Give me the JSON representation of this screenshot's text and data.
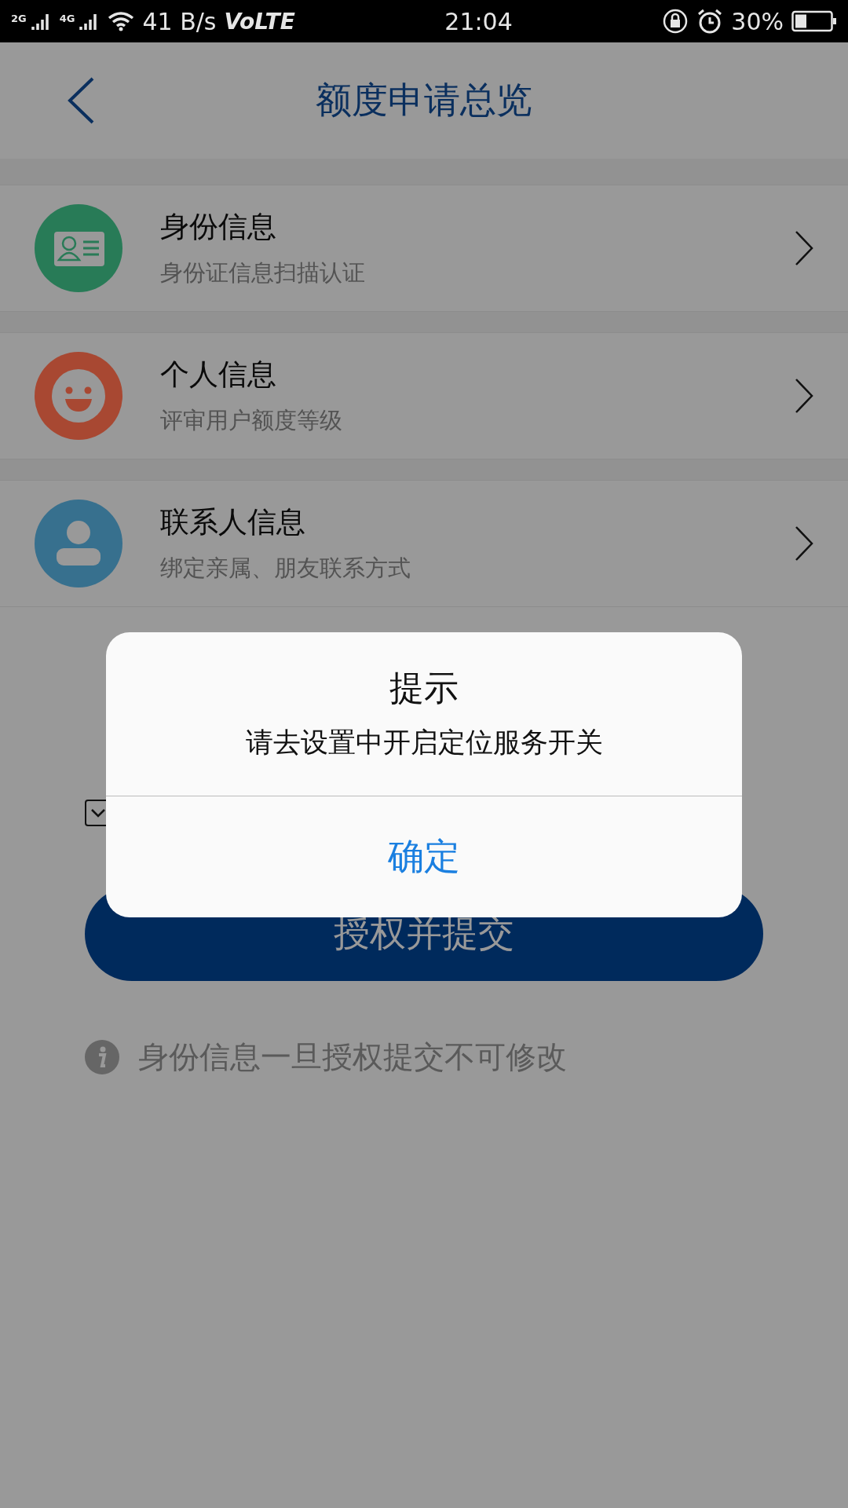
{
  "status_bar": {
    "network_1": "2G",
    "network_2": "4G",
    "speed": "41 B/s",
    "volte": "VoLTE",
    "time": "21:04",
    "battery": "30%"
  },
  "header": {
    "title": "额度申请总览"
  },
  "items": [
    {
      "kind": "id-card",
      "title": "身份信息",
      "subtitle": "身份证信息扫描认证",
      "color": "#287b57"
    },
    {
      "kind": "smile",
      "title": "个人信息",
      "subtitle": "评审用户额度等级",
      "color": "#a84832"
    },
    {
      "kind": "person",
      "title": "联系人信息",
      "subtitle": "绑定亲属、朋友联系方式",
      "color": "#37708e"
    }
  ],
  "agreement": {
    "checked": true
  },
  "submit_button": "授权并提交",
  "notice": "身份信息一旦授权提交不可修改",
  "dialog": {
    "title": "提示",
    "message": "请去设置中开启定位服务开关",
    "button": "确定"
  }
}
